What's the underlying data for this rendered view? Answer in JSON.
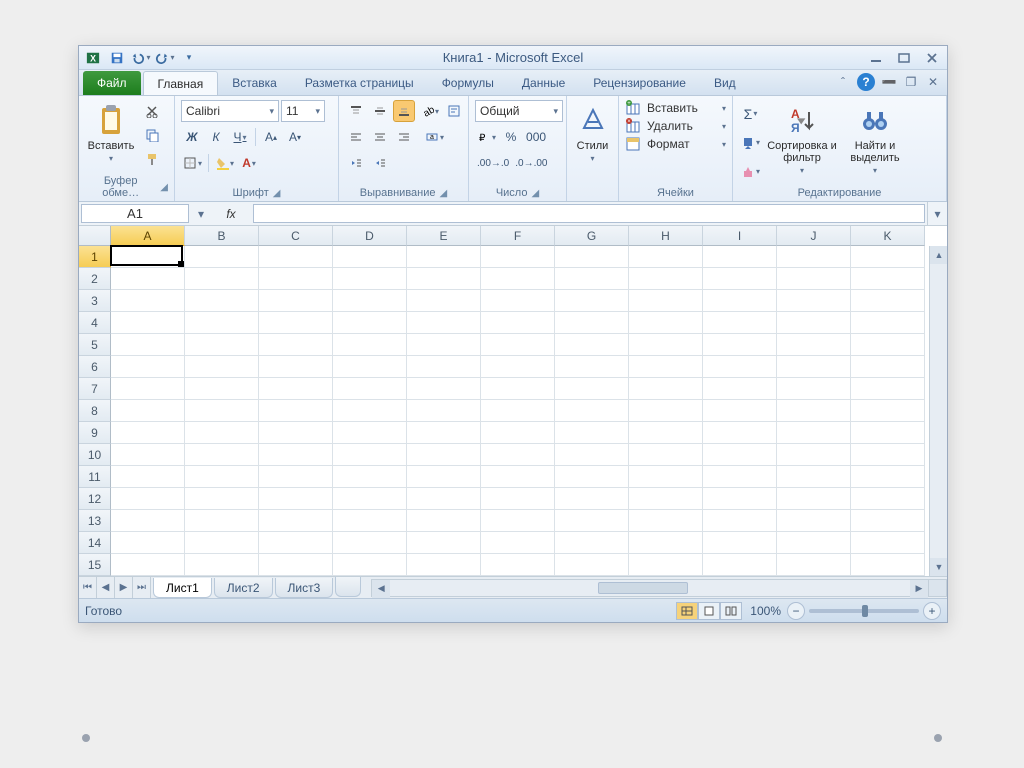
{
  "title": "Книга1  -  Microsoft Excel",
  "qat": {
    "excel": "X",
    "save": "save",
    "undo": "undo",
    "redo": "redo"
  },
  "window_controls": {
    "min": "minimize",
    "max": "maximize",
    "close": "close"
  },
  "tabs": {
    "file": "Файл",
    "items": [
      "Главная",
      "Вставка",
      "Разметка страницы",
      "Формулы",
      "Данные",
      "Рецензирование",
      "Вид"
    ],
    "active": 0
  },
  "ribbon": {
    "clipboard": {
      "label": "Буфер обме…",
      "paste": "Вставить"
    },
    "font": {
      "label": "Шрифт",
      "name": "Calibri",
      "size": "11",
      "bold": "Ж",
      "italic": "К",
      "underline": "Ч"
    },
    "alignment": {
      "label": "Выравнивание"
    },
    "number": {
      "label": "Число",
      "format": "Общий"
    },
    "styles": {
      "label": "Стили"
    },
    "cells": {
      "label": "Ячейки",
      "insert": "Вставить",
      "delete": "Удалить",
      "format": "Формат"
    },
    "editing": {
      "label": "Редактирование",
      "sort": "Сортировка и фильтр",
      "find": "Найти и выделить"
    }
  },
  "namebox": "A1",
  "fx": "fx",
  "columns": [
    "A",
    "B",
    "C",
    "D",
    "E",
    "F",
    "G",
    "H",
    "I",
    "J",
    "K"
  ],
  "rows": [
    "1",
    "2",
    "3",
    "4",
    "5",
    "6",
    "7",
    "8",
    "9",
    "10",
    "11",
    "12",
    "13",
    "14",
    "15"
  ],
  "active_cell": {
    "col": 0,
    "row": 0
  },
  "sheets": {
    "items": [
      "Лист1",
      "Лист2",
      "Лист3"
    ],
    "active": 0
  },
  "status": {
    "ready": "Готово",
    "zoom": "100%"
  }
}
